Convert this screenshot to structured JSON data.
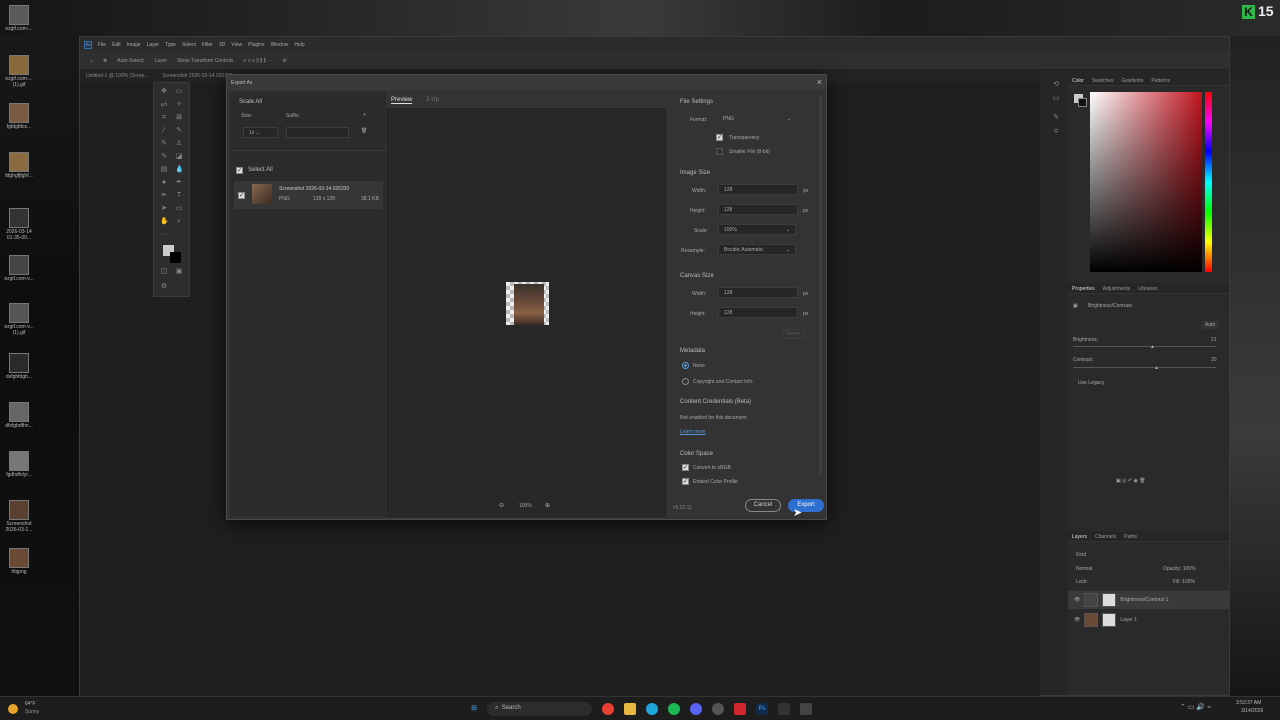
{
  "badge": {
    "letter": "K",
    "number": "15"
  },
  "desktop_icons": [
    {
      "label": "ezgif.com-..."
    },
    {
      "label": "ezgif.com-... (1).gif"
    },
    {
      "label": "fgfdgfdcs..."
    },
    {
      "label": "fdghgfjfghf..."
    },
    {
      "label": "2026-03-14 01-35-00..."
    },
    {
      "label": "ezgif.com-v..."
    },
    {
      "label": "ezgif.com-v... (1).gif"
    },
    {
      "label": "dsfghfdgh..."
    },
    {
      "label": "dfsfgbdfhn..."
    },
    {
      "label": "fgdhdfvlyr..."
    },
    {
      "label": "Screenshot 2026-03-1..."
    },
    {
      "label": "hbjpng"
    }
  ],
  "menu": [
    "File",
    "Edit",
    "Image",
    "Layer",
    "Type",
    "Select",
    "Filter",
    "3D",
    "View",
    "Plugins",
    "Window",
    "Help"
  ],
  "options": {
    "auto_select": "Auto-Select:",
    "layer": "Layer",
    "show_transform": "Show Transform Controls"
  },
  "doc_tab": "Untitled-1 @ 100% (Scree...",
  "doc_tab2": "Screenshot 2026-03-14 035330, La...",
  "panels": {
    "color_tabs": [
      "Color",
      "Swatches",
      "Gradients",
      "Patterns"
    ],
    "prop_tabs": [
      "Properties",
      "Adjustments",
      "Libraries"
    ],
    "prop_title": "Brightness/Contrast",
    "auto": "Auto",
    "brightness": "Brightness:",
    "brightness_val": "21",
    "contrast": "Contrast:",
    "contrast_val": "20",
    "use_legacy": "Use Legacy",
    "layer_tabs": [
      "Layers",
      "Channels",
      "Paths"
    ],
    "kind": "Kind",
    "normal": "Normal",
    "opacity": "Opacity: 100%",
    "lock": "Lock:",
    "fill": "Fill: 100%",
    "layers": [
      "Brightness/Contrast 1",
      "Layer 1"
    ]
  },
  "dialog": {
    "title": "Export As",
    "scale_all": "Scale All",
    "size": "Size:",
    "suffix": "Suffix:",
    "scale": "1x",
    "select_all": "Select All",
    "asset_name": "Screenshot 2026-03-14 035330",
    "asset_format": "PNG",
    "asset_dims": "128 x 128",
    "asset_size": "38.1 KB",
    "tab_preview": "Preview",
    "tab_2up": "2-Up",
    "zoom": "100%",
    "file_settings": "File Settings",
    "format_label": "Format:",
    "format_val": "PNG",
    "transparency": "Transparency",
    "smaller_file": "Smaller File (8-bit)",
    "image_size": "Image Size",
    "width": "Width:",
    "width_val": "128",
    "px": "px",
    "height": "Height:",
    "height_val": "128",
    "scale_label": "Scale:",
    "scale_val": "100%",
    "resample": "Resample:",
    "resample_val": "Bicubic Automatic",
    "canvas_size": "Canvas Size",
    "cwidth_val": "128",
    "cheight_val": "128",
    "reset": "Reset",
    "metadata": "Metadata",
    "none": "None",
    "copyright": "Copyright and Contact Info",
    "content_cred": "Content Credentials (Beta)",
    "not_enabled": "Not enabled for this document",
    "learn_more": "Learn more",
    "color_space": "Color Space",
    "convert_srgb": "Convert to sRGB",
    "embed_profile": "Embed Color Profile",
    "version": "v5.12.11",
    "cancel": "Cancel",
    "export": "Export"
  },
  "taskbar": {
    "weather_temp": "64°F",
    "weather_desc": "Sunny",
    "search": "Search",
    "time": "3:53:37 AM",
    "date": "3/14/2026"
  }
}
